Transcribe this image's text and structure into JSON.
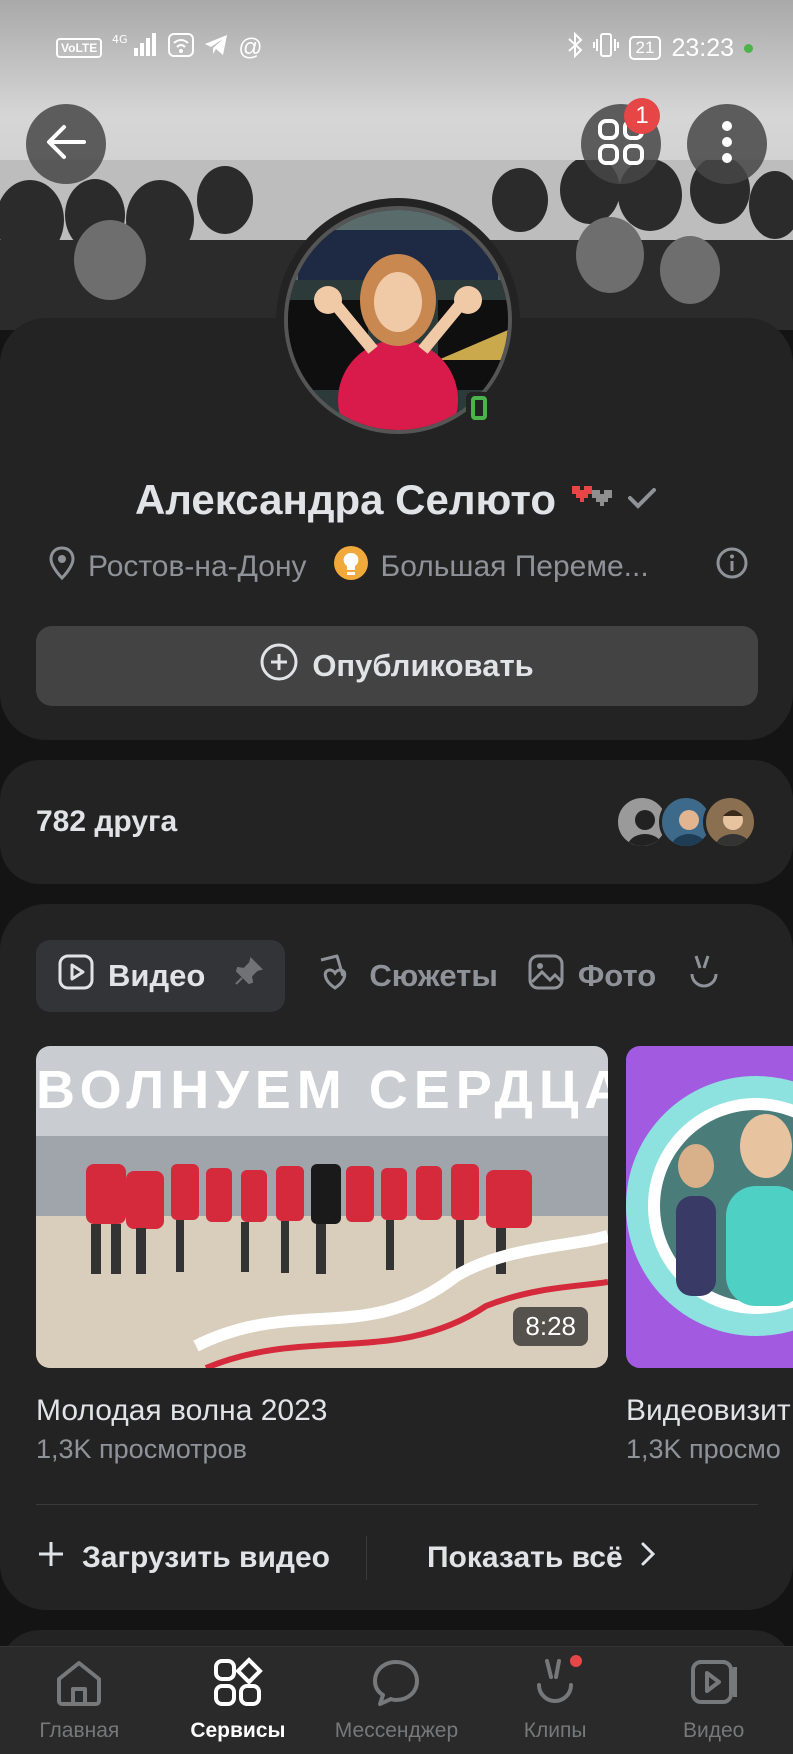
{
  "status_bar": {
    "net_chip": "VoLTE",
    "signal_label": "4G",
    "battery": "21",
    "time": "23:23"
  },
  "header": {
    "notifications_badge": "1"
  },
  "profile": {
    "name": "Александра Селюто",
    "city": "Ростов-на-Дону",
    "community": "Большая Переме...",
    "publish_label": "Опубликовать"
  },
  "friends": {
    "label": "782 друга"
  },
  "media": {
    "tabs": [
      {
        "label": "Видео",
        "active": true
      },
      {
        "label": "Сюжеты",
        "active": false
      },
      {
        "label": "Фото",
        "active": false
      }
    ],
    "videos": [
      {
        "overlay_text": "ВОЛНУЕМ СЕРДЦА",
        "title": "Молодая волна 2023",
        "views": "1,3K просмотров",
        "duration": "8:28"
      },
      {
        "title": "Видеовизит",
        "views": "1,3K просмо"
      }
    ],
    "upload_label": "Загрузить видео",
    "show_all_label": "Показать всё"
  },
  "bottom_nav": {
    "items": [
      {
        "label": "Главная",
        "icon": "home-icon"
      },
      {
        "label": "Сервисы",
        "icon": "services-icon"
      },
      {
        "label": "Мессенджер",
        "icon": "messenger-icon"
      },
      {
        "label": "Клипы",
        "icon": "clips-icon"
      },
      {
        "label": "Видео",
        "icon": "video-icon"
      }
    ]
  },
  "colors": {
    "background": "#141414",
    "card": "#232323",
    "accent_red": "#e64646",
    "online_green": "#4bb34b",
    "secondary_text": "#8f9399"
  }
}
